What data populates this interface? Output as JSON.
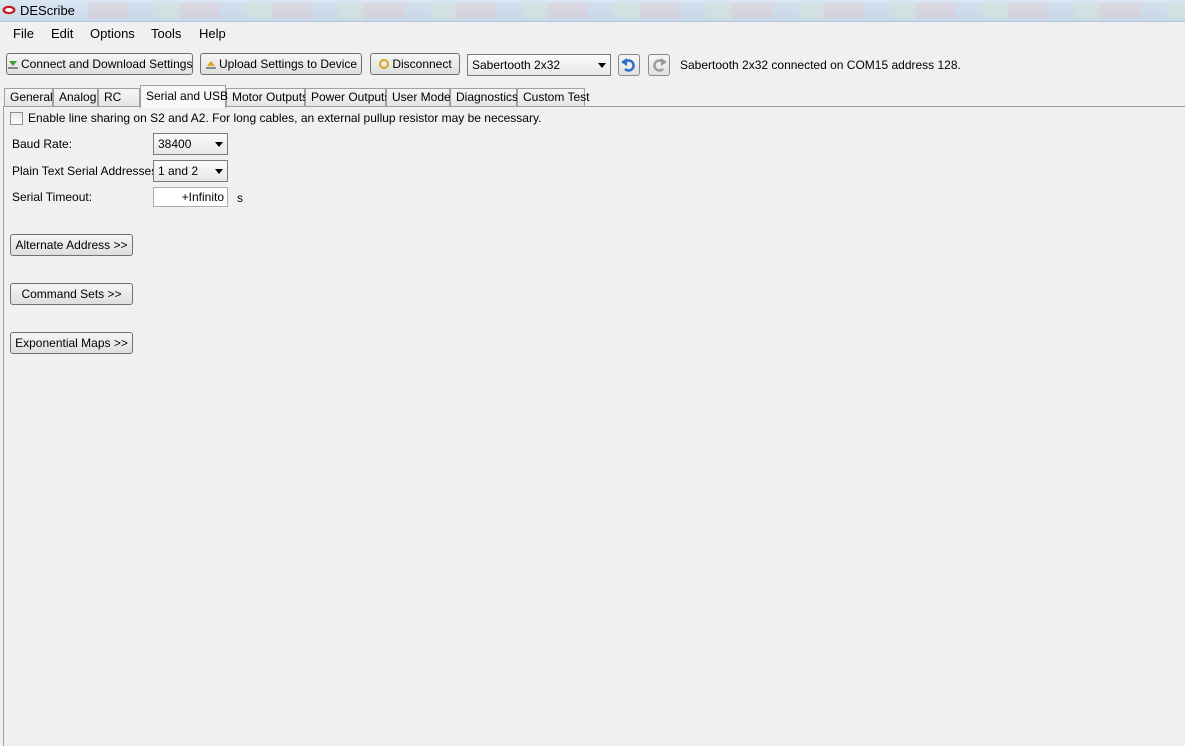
{
  "window": {
    "title": "DEScribe"
  },
  "menu": [
    "File",
    "Edit",
    "Options",
    "Tools",
    "Help"
  ],
  "toolbar": {
    "connect_label": "Connect and Download Settings",
    "upload_label": "Upload Settings to Device",
    "disconnect_label": "Disconnect",
    "device_selected": "Sabertooth 2x32",
    "undo_icon": "undo-icon",
    "redo_icon": "redo-icon",
    "status": "Sabertooth 2x32 connected on COM15 address 128."
  },
  "tabs": [
    "General",
    "Analog",
    "RC",
    "Serial and USB",
    "Motor Outputs",
    "Power Outputs",
    "User Mode",
    "Diagnostics",
    "Custom Test"
  ],
  "active_tab": "Serial and USB",
  "serial": {
    "line_sharing_label": "Enable line sharing on S2 and A2. For long cables, an external pullup resistor may be necessary.",
    "line_sharing_checked": false,
    "baud_rate_label": "Baud Rate:",
    "baud_rate_value": "38400",
    "plain_text_label": "Plain Text Serial Addresses:",
    "plain_text_value": "1 and 2",
    "timeout_label": "Serial Timeout:",
    "timeout_value": "+Infinito",
    "timeout_unit": "s",
    "alternate_address_label": "Alternate Address >>",
    "command_sets_label": "Command Sets >>",
    "exponential_maps_label": "Exponential Maps >>"
  }
}
